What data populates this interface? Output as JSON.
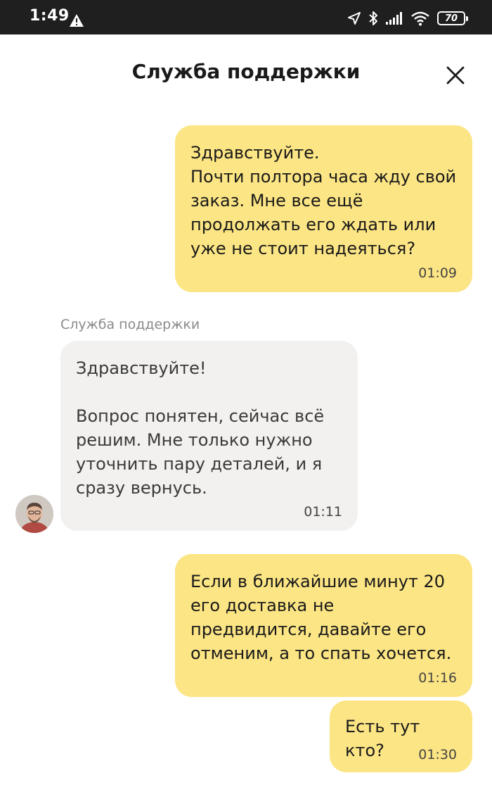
{
  "status_bar": {
    "time": "1:49",
    "battery": "70",
    "icons": [
      "warning-icon",
      "location-icon",
      "bluetooth-icon",
      "signal-icon",
      "wifi-icon",
      "battery-icon"
    ]
  },
  "header": {
    "title": "Служба поддержки",
    "close_icon": "close-icon"
  },
  "messages": [
    {
      "direction": "outgoing",
      "text": "Здравствуйте.\nПочти полтора часа жду свой заказ. Мне все ещё продолжать его ждать или уже не стоит надеяться?",
      "time": "01:09"
    },
    {
      "direction": "incoming",
      "sender": "Служба поддержки",
      "text": "Здравствуйте!\n\nВопрос понятен, сейчас всё решим. Мне только нужно уточнить пару деталей, и я сразу вернусь.",
      "time": "01:11"
    },
    {
      "direction": "outgoing",
      "text": "Если в ближайшие минут 20 его доставка не предвидится, давайте его отменим, а то спать хочется.",
      "time": "01:16"
    },
    {
      "direction": "outgoing",
      "text": "Есть тут кто?",
      "time": "01:30"
    }
  ],
  "colors": {
    "status_bar_bg": "#1f1f1f",
    "outgoing_bubble": "#fce584",
    "incoming_bubble": "#f2f1ef"
  }
}
